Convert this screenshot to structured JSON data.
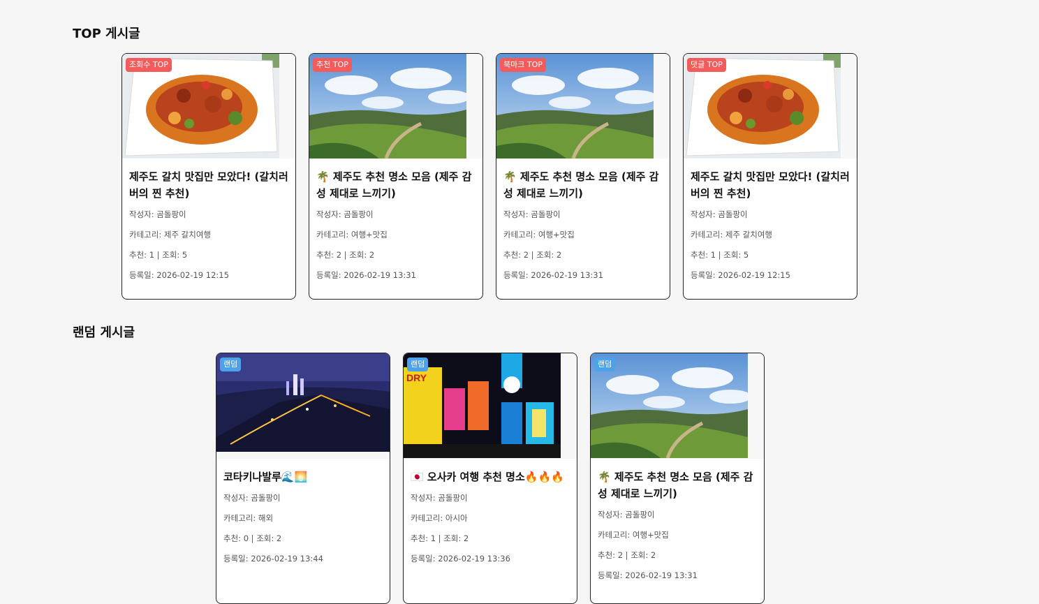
{
  "sections": {
    "top_title": "TOP 게시글",
    "random_title": "랜덤 게시글"
  },
  "labels": {
    "author": "작성자:",
    "category": "카테고리:",
    "recommend": "추천:",
    "views": "조회:",
    "date": "등록일:"
  },
  "top_posts": [
    {
      "badge": "조회수 TOP",
      "image": "food-dish",
      "title": "제주도 갈치 맛집만 모았다! (갈치러버의 찐 추천)",
      "author": "곰돌팡이",
      "category": "제주 갈치여행",
      "recommend": "1",
      "views": "5",
      "date": "2026-02-19 12:15"
    },
    {
      "badge": "추천 TOP",
      "image": "green-hill",
      "title": "🌴 제주도 추천 명소 모음 (제주 감성 제대로 느끼기)",
      "author": "곰돌팡이",
      "category": "여행+맛집",
      "recommend": "2",
      "views": "2",
      "date": "2026-02-19 13:31"
    },
    {
      "badge": "북마크 TOP",
      "image": "green-hill",
      "title": "🌴 제주도 추천 명소 모음 (제주 감성 제대로 느끼기)",
      "author": "곰돌팡이",
      "category": "여행+맛집",
      "recommend": "2",
      "views": "2",
      "date": "2026-02-19 13:31"
    },
    {
      "badge": "댓글 TOP",
      "image": "food-dish",
      "title": "제주도 갈치 맛집만 모았다! (갈치러버의 찐 추천)",
      "author": "곰돌팡이",
      "category": "제주 갈치여행",
      "recommend": "1",
      "views": "5",
      "date": "2026-02-19 12:15"
    }
  ],
  "random_posts": [
    {
      "badge": "랜덤",
      "image": "night-city",
      "title": "코타키나발루🌊🌅",
      "author": "곰돌팡이",
      "category": "해외",
      "recommend": "0",
      "views": "2",
      "date": "2026-02-19 13:44"
    },
    {
      "badge": "랜덤",
      "image": "neon-street",
      "title": "🇯🇵 오사카 여행 추천 명소🔥🔥🔥",
      "author": "곰돌팡이",
      "category": "아시아",
      "recommend": "1",
      "views": "2",
      "date": "2026-02-19 13:36"
    },
    {
      "badge": "랜덤",
      "image": "green-hill",
      "title": "🌴 제주도 추천 명소 모음 (제주 감성 제대로 느끼기)",
      "author": "곰돌팡이",
      "category": "여행+맛집",
      "recommend": "2",
      "views": "2",
      "date": "2026-02-19 13:31"
    }
  ]
}
